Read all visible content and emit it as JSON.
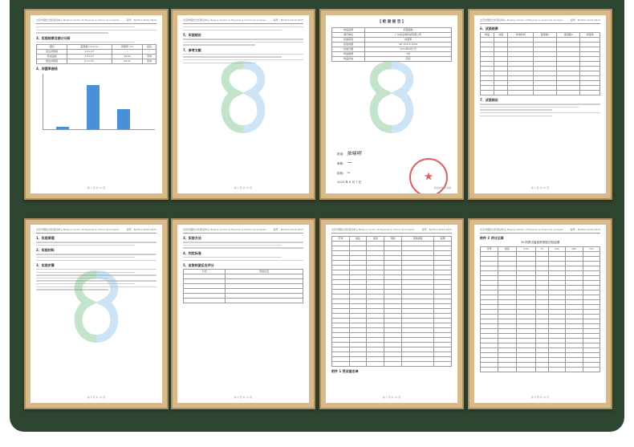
{
  "pages": [
    {
      "id": "p1",
      "header_left": "北京市理化分析测试中心 Beijing Centre of Physical & Chemical Analysis",
      "header_right": "编号：BJCPCA-2023-0815",
      "sections": [
        "3、实验结果及统计分析",
        "4、抑菌率曲线"
      ],
      "table_cols": [
        "组别",
        "菌落数 (cfu/mL)",
        "抑菌率 (%)",
        "结论"
      ],
      "table_rows": [
        [
          "空白对照组",
          "2.0×10⁵",
          "/",
          "/"
        ],
        [
          "供试品组",
          "3.0×10²",
          "99.85",
          "有效"
        ],
        [
          "阳性对照组",
          "5.0×10¹",
          "99.97",
          "有效"
        ]
      ],
      "chart_data": {
        "type": "bar",
        "categories": [
          "空白对照组",
          "供试品组",
          "阳性对照组"
        ],
        "values": [
          3,
          52,
          24
        ],
        "ylim": [
          0,
          60
        ]
      },
      "footer": "第 1 页 共 12 页"
    },
    {
      "id": "p2",
      "header_left": "北京市理化分析测试中心 Beijing Centre of Physical & Chemical Analysis",
      "header_right": "编号：BJCPCA-2023-0815",
      "sections": [
        "5、实验结论",
        "7、参考文献"
      ],
      "footer": "第 2 页 共 12 页"
    },
    {
      "id": "p3",
      "title": "【 检 验 报 告 】",
      "rows": [
        [
          "样品名称",
          "抑菌凝胶"
        ],
        [
          "委托单位",
          "广州某生物科技有限公司"
        ],
        [
          "检验项目",
          "抑菌率"
        ],
        [
          "检验依据",
          "GB 15979-2002"
        ],
        [
          "检验日期",
          "2023年6月7日"
        ],
        [
          "样品数量",
          "3支"
        ],
        [
          "样品状态",
          "完好"
        ]
      ],
      "signatures": [
        "批准：",
        "审核：",
        "检验："
      ],
      "sign_names": [
        "张晓明",
        "一"
      ],
      "date": "2023 年 6 月 7 日",
      "footer": "检验报告专用章"
    },
    {
      "id": "p4",
      "header_left": "北京市理化分析测试中心 Beijing Centre of Physical & Chemical Analysis",
      "header_right": "编号：BJCPCA-2023-0815",
      "sections": [
        "6、试验结果",
        "7、试验结论"
      ],
      "table_cols": [
        "样品",
        "浓度",
        "作用时间",
        "菌落数1",
        "菌落数2",
        "抑菌率"
      ],
      "footer": "第 4 页 共 12 页"
    },
    {
      "id": "p5",
      "header_left": "北京市理化分析测试中心 Beijing Centre of Physical & Chemical Analysis",
      "header_right": "编号：BJCPCA-2023-0815",
      "sections": [
        "1、实验原理",
        "2、实验材料",
        "3、实验步骤"
      ],
      "footer": "第 5 页 共 12 页"
    },
    {
      "id": "p6",
      "header_left": "北京市理化分析测试中心 Beijing Centre of Physical & Chemical Analysis",
      "header_right": "编号：BJCPCA-2023-0815",
      "sections": [
        "3、实验方法",
        "4、判定标准",
        "5、皮肤刺激反应评分"
      ],
      "table_cols": [
        "分值",
        "皮肤反应"
      ],
      "footer": "第 6 页 共 12 页"
    },
    {
      "id": "p7",
      "header_left": "北京市理化分析测试中心 Beijing Centre of Physical & Chemical Analysis",
      "header_right": "编号：BJCPCA-2023-0815",
      "sections": [
        "附件 1  受试者名单"
      ],
      "table_cols": [
        "序号",
        "姓名",
        "性别",
        "年龄",
        "皮肤类型",
        "结果"
      ],
      "footer": "第 7 页 共 12 页"
    },
    {
      "id": "p8",
      "header_left": "北京市理化分析测试中心 Beijing Centre of Physical & Chemical Analysis",
      "header_right": "编号：BJCPCA-2023-0815",
      "sections": [
        "附件 2  评分记录",
        "30 例受试者皮肤斑贴试验结果"
      ],
      "table_cols": [
        "序号",
        "姓名",
        "0.5h",
        "1h",
        "24h",
        "48h",
        "72h"
      ],
      "footer": "第 8 页 共 12 页"
    }
  ],
  "colors": {
    "board": "#2e4631",
    "frame": "#d8b98a",
    "bar": "#4a90d9",
    "stamp": "#d23b3b",
    "watermark_green": "#57b26a",
    "watermark_blue": "#6fb3e6"
  }
}
